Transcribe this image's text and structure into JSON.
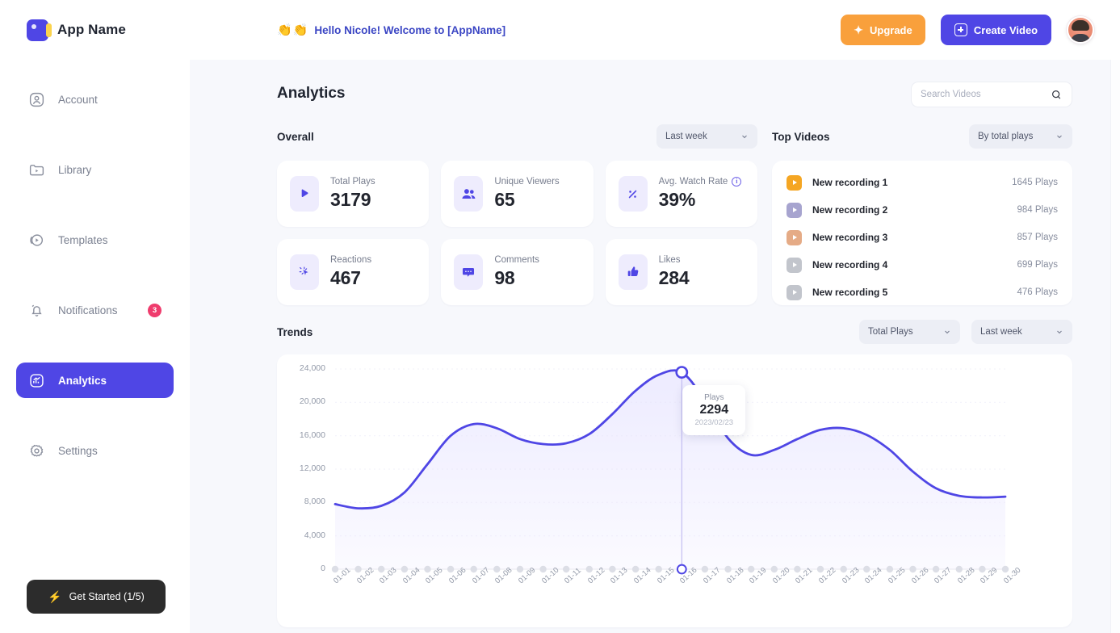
{
  "header": {
    "brand_name": "App Name",
    "logo_icon": "app-logo-icon",
    "greeting_emoji": "👏👏",
    "greeting": "Hello Nicole! Welcome to [AppName]",
    "upgrade_label": "Upgrade",
    "upgrade_icon": "sparkle-icon",
    "create_label": "Create Video",
    "create_icon": "plus-square-icon",
    "avatar": "user-avatar",
    "upgrade_color": "#f9a03c",
    "create_color": "#4f46e5"
  },
  "sidebar": {
    "items": [
      {
        "label": "Account",
        "icon": "account-icon",
        "active": false,
        "badge": ""
      },
      {
        "label": "Library",
        "icon": "library-icon",
        "active": false,
        "badge": ""
      },
      {
        "label": "Templates",
        "icon": "templates-icon",
        "active": false,
        "badge": ""
      },
      {
        "label": "Notifications",
        "icon": "bell-icon",
        "active": false,
        "badge": "3"
      },
      {
        "label": "Analytics",
        "icon": "analytics-icon",
        "active": true,
        "badge": ""
      },
      {
        "label": "Settings",
        "icon": "gear-icon",
        "active": false,
        "badge": ""
      }
    ],
    "badge_color": "#ef3c6d",
    "active_color": "#4f46e5",
    "get_started": {
      "label": "Get Started (1/5)",
      "icon": "bolt-icon"
    }
  },
  "main": {
    "page_title": "Analytics",
    "search": {
      "placeholder": "Search Videos",
      "value": "",
      "icon": "search-icon"
    },
    "overall": {
      "title": "Overall",
      "range_filter": "Last week",
      "cards": [
        {
          "label": "Total Plays",
          "value": "3179",
          "icon": "play-icon",
          "info": false
        },
        {
          "label": "Unique Viewers",
          "value": "65",
          "icon": "users-icon",
          "info": false
        },
        {
          "label": "Avg. Watch Rate",
          "value": "39%",
          "icon": "percent-icon",
          "info": true
        },
        {
          "label": "Reactions",
          "value": "467",
          "icon": "click-icon",
          "info": false
        },
        {
          "label": "Comments",
          "value": "98",
          "icon": "comment-icon",
          "info": false
        },
        {
          "label": "Likes",
          "value": "284",
          "icon": "thumbs-up-icon",
          "info": false
        }
      ]
    },
    "top_videos": {
      "title": "Top Videos",
      "sort_filter": "By total plays",
      "rows": [
        {
          "name": "New recording 1",
          "plays": "1645 Plays",
          "thumb_color": "#f5a623"
        },
        {
          "name": "New recording 2",
          "plays": "984 Plays",
          "thumb_color": "#a7a4cf"
        },
        {
          "name": "New recording 3",
          "plays": "857 Plays",
          "thumb_color": "#e5ab86"
        },
        {
          "name": "New recording 4",
          "plays": "699 Plays",
          "thumb_color": "#c2c5cc"
        },
        {
          "name": "New recording 5",
          "plays": "476 Plays",
          "thumb_color": "#c2c5cc"
        }
      ]
    },
    "trends": {
      "title": "Trends",
      "metric_filter": "Total Plays",
      "range_filter": "Last week",
      "tooltip": {
        "label": "Plays",
        "value": "2294",
        "date": "2023/02/23"
      }
    }
  },
  "chart_data": {
    "type": "area",
    "title": "Trends",
    "xlabel": "",
    "ylabel": "",
    "ylim": [
      0,
      24000
    ],
    "yticks": [
      0,
      4000,
      8000,
      12000,
      16000,
      20000,
      24000
    ],
    "ytick_labels": [
      "0",
      "4,000",
      "8,000",
      "12,000",
      "16,000",
      "20,000",
      "24,000"
    ],
    "grid": false,
    "legend": false,
    "line_color": "#4f46e5",
    "fill_color": "#eceaff",
    "series": [
      {
        "name": "Total Plays",
        "values": [
          7800,
          7300,
          7600,
          9200,
          12600,
          16000,
          17400,
          16900,
          15600,
          15000,
          15100,
          16200,
          18600,
          21400,
          23300,
          23600,
          20200,
          15700,
          13700,
          14300,
          15600,
          16700,
          16900,
          16100,
          14300,
          11700,
          9700,
          8800,
          8600,
          8700
        ]
      }
    ],
    "categories": [
      "01-01",
      "01-02",
      "01-03",
      "01-04",
      "01-05",
      "01-06",
      "01-07",
      "01-08",
      "01-09",
      "01-10",
      "01-11",
      "01-12",
      "01-13",
      "01-14",
      "01-15",
      "01-16",
      "01-17",
      "01-18",
      "01-19",
      "01-20",
      "01-21",
      "01-22",
      "01-23",
      "01-24",
      "01-25",
      "01-26",
      "01-27",
      "01-28",
      "01-29",
      "01-30"
    ],
    "highlight": {
      "category": "01-16",
      "value": 2294,
      "date": "2023/02/23"
    }
  }
}
